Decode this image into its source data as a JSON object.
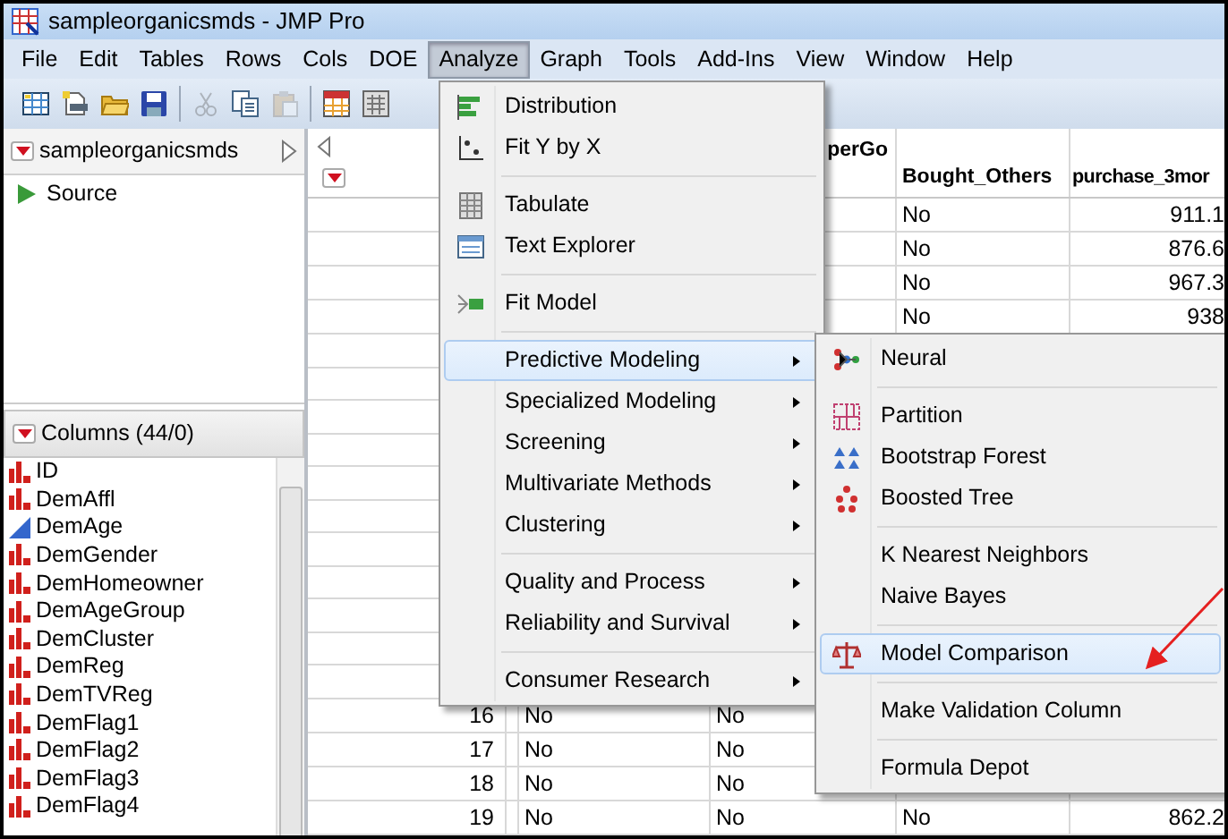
{
  "window": {
    "title": "sampleorganicsmds - JMP Pro"
  },
  "menu_bar": [
    {
      "label": "File",
      "selected": false
    },
    {
      "label": "Edit",
      "selected": false
    },
    {
      "label": "Tables",
      "selected": false
    },
    {
      "label": "Rows",
      "selected": false
    },
    {
      "label": "Cols",
      "selected": false
    },
    {
      "label": "DOE",
      "selected": false
    },
    {
      "label": "Analyze",
      "selected": true
    },
    {
      "label": "Graph",
      "selected": false
    },
    {
      "label": "Tools",
      "selected": false
    },
    {
      "label": "Add-Ins",
      "selected": false
    },
    {
      "label": "View",
      "selected": false
    },
    {
      "label": "Window",
      "selected": false
    },
    {
      "label": "Help",
      "selected": false
    }
  ],
  "toolbar": [
    {
      "disabled": false
    },
    {
      "disabled": false
    },
    {
      "disabled": false
    },
    {
      "disabled": false
    },
    {
      "disabled": true
    },
    {
      "disabled": false
    },
    {
      "disabled": true
    },
    {
      "disabled": false
    },
    {
      "disabled": false
    }
  ],
  "table_panel": {
    "title": "sampleorganicsmds",
    "items": [
      {
        "label": "Source"
      }
    ]
  },
  "columns_panel": {
    "title": "Columns (44/0)",
    "columns": [
      {
        "name": "ID",
        "kind": "nominal"
      },
      {
        "name": "DemAffl",
        "kind": "nominal"
      },
      {
        "name": "DemAge",
        "kind": "continuous"
      },
      {
        "name": "DemGender",
        "kind": "nominal"
      },
      {
        "name": "DemHomeowner",
        "kind": "nominal"
      },
      {
        "name": "DemAgeGroup",
        "kind": "nominal"
      },
      {
        "name": "DemCluster",
        "kind": "nominal"
      },
      {
        "name": "DemReg",
        "kind": "nominal"
      },
      {
        "name": "DemTVReg",
        "kind": "nominal"
      },
      {
        "name": "DemFlag1",
        "kind": "nominal"
      },
      {
        "name": "DemFlag2",
        "kind": "nominal"
      },
      {
        "name": "DemFlag3",
        "kind": "nominal"
      },
      {
        "name": "DemFlag4",
        "kind": "nominal"
      }
    ]
  },
  "table": {
    "headers": {
      "column_2": "perGo",
      "bought_others": "Bought_Others",
      "purchase_3mor": "purchase_3mor"
    },
    "top_rows": [
      {
        "bought_others": "No",
        "purchase_3mor": "911.1"
      },
      {
        "bought_others": "No",
        "purchase_3mor": "876.6"
      },
      {
        "bought_others": "No",
        "purchase_3mor": "967.3"
      },
      {
        "bought_others": "No",
        "purchase_3mor": "938"
      }
    ],
    "bottom_rows": [
      {
        "row_number": "16",
        "column_1": "No",
        "column_2": "No"
      },
      {
        "row_number": "17",
        "column_1": "No",
        "column_2": "No"
      },
      {
        "row_number": "18",
        "column_1": "No",
        "column_2": "No"
      },
      {
        "row_number": "19",
        "column_1": "No",
        "column_2": "No",
        "bought_others": "No",
        "purchase_3mor": "862.2"
      }
    ]
  },
  "analyze_menu": {
    "items": [
      {
        "kind": "item",
        "label": "Distribution",
        "has_submenu": false,
        "selected": false
      },
      {
        "kind": "item",
        "label": "Fit Y by X",
        "has_submenu": false,
        "selected": false
      },
      {
        "kind": "separator"
      },
      {
        "kind": "item",
        "label": "Tabulate",
        "has_submenu": false,
        "selected": false
      },
      {
        "kind": "item",
        "label": "Text Explorer",
        "has_submenu": false,
        "selected": false
      },
      {
        "kind": "separator"
      },
      {
        "kind": "item",
        "label": "Fit Model",
        "has_submenu": false,
        "selected": false
      },
      {
        "kind": "separator"
      },
      {
        "kind": "item",
        "label": "Predictive Modeling",
        "has_submenu": true,
        "selected": true
      },
      {
        "kind": "item",
        "label": "Specialized Modeling",
        "has_submenu": true,
        "selected": false
      },
      {
        "kind": "item",
        "label": "Screening",
        "has_submenu": true,
        "selected": false
      },
      {
        "kind": "item",
        "label": "Multivariate Methods",
        "has_submenu": true,
        "selected": false
      },
      {
        "kind": "item",
        "label": "Clustering",
        "has_submenu": true,
        "selected": false
      },
      {
        "kind": "separator"
      },
      {
        "kind": "item",
        "label": "Quality and Process",
        "has_submenu": true,
        "selected": false
      },
      {
        "kind": "item",
        "label": "Reliability and Survival",
        "has_submenu": true,
        "selected": false
      },
      {
        "kind": "separator"
      },
      {
        "kind": "item",
        "label": "Consumer Research",
        "has_submenu": true,
        "selected": false
      }
    ]
  },
  "predictive_modeling_submenu": {
    "items": [
      {
        "kind": "item",
        "label": "Neural",
        "selected": false
      },
      {
        "kind": "separator"
      },
      {
        "kind": "item",
        "label": "Partition",
        "selected": false
      },
      {
        "kind": "item",
        "label": "Bootstrap Forest",
        "selected": false
      },
      {
        "kind": "item",
        "label": "Boosted Tree",
        "selected": false
      },
      {
        "kind": "separator"
      },
      {
        "kind": "item",
        "label": "K Nearest Neighbors",
        "selected": false
      },
      {
        "kind": "item",
        "label": "Naive Bayes",
        "selected": false
      },
      {
        "kind": "separator"
      },
      {
        "kind": "item",
        "label": "Model Comparison",
        "selected": true
      },
      {
        "kind": "separator"
      },
      {
        "kind": "item",
        "label": "Make Validation Column",
        "selected": false
      },
      {
        "kind": "separator"
      },
      {
        "kind": "item",
        "label": "Formula Depot",
        "selected": false
      }
    ]
  }
}
